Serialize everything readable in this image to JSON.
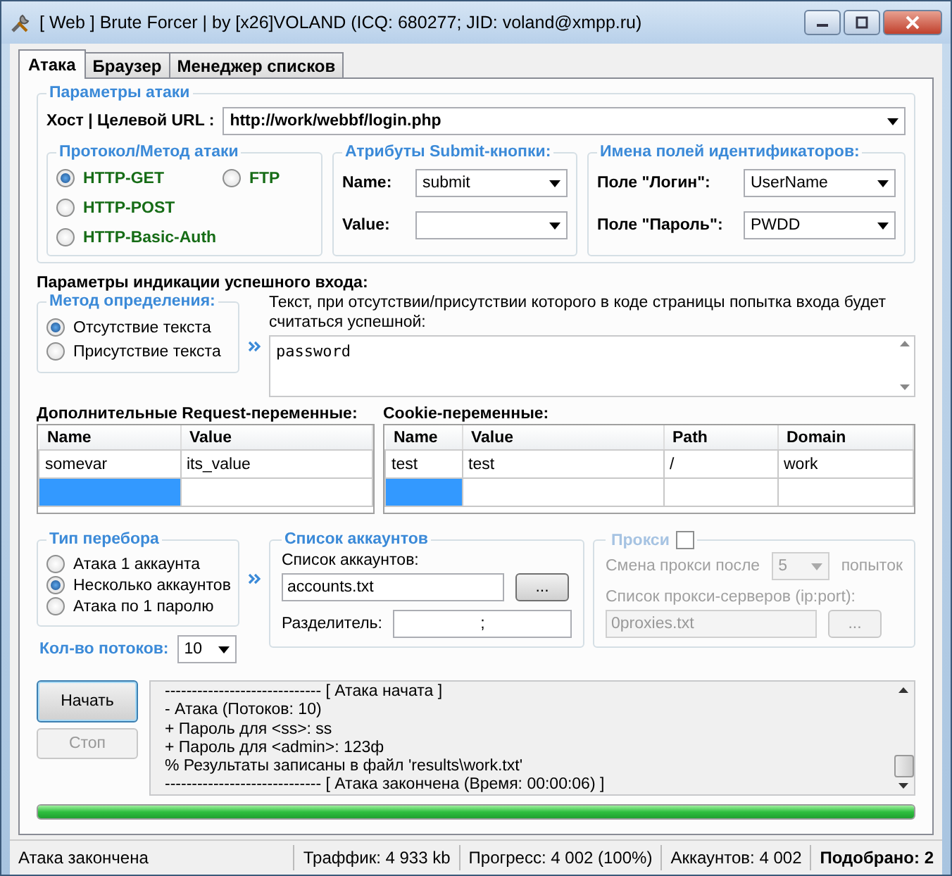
{
  "window": {
    "title": "[ Web ] Brute Forcer | by [x26]VOLAND (ICQ: 680277; JID: voland@xmpp.ru)"
  },
  "tabs": [
    {
      "label": "Атака",
      "selected": true
    },
    {
      "label": "Браузер",
      "selected": false
    },
    {
      "label": "Менеджер списков",
      "selected": false
    }
  ],
  "attack_params": {
    "title": "Параметры атаки",
    "host_label": "Хост | Целевой URL :",
    "host_value": "http://work/webbf/login.php"
  },
  "protocol": {
    "title": "Протокол/Метод атаки",
    "options": [
      {
        "label": "HTTP-GET",
        "selected": true
      },
      {
        "label": "FTP",
        "selected": false
      },
      {
        "label": "HTTP-POST",
        "selected": false
      },
      {
        "label": "HTTP-Basic-Auth",
        "selected": false
      }
    ]
  },
  "submit_attrs": {
    "title": "Атрибуты Submit-кнопки:",
    "fields": [
      {
        "label": "Name:",
        "value": "submit"
      },
      {
        "label": "Value:"
      }
    ]
  },
  "id_fields": {
    "title": "Имена полей идентификаторов:",
    "fields": [
      {
        "label": "Поле \"Логин\":",
        "value": "UserName"
      },
      {
        "label": "Поле \"Пароль\":",
        "value": "PWDD"
      }
    ]
  },
  "success": {
    "heading": "Параметры индикации успешного входа:",
    "method_title": "Метод определения:",
    "options": [
      {
        "label": "Отсутствие текста",
        "selected": true
      },
      {
        "label": "Присутствие текста",
        "selected": false
      }
    ],
    "description": "Текст, при отсутствии/присутствии которого в коде страницы попытка входа будет считаться успешной:",
    "text_value": "password"
  },
  "request_vars": {
    "title": "Дополнительные Request-переменные:",
    "columns": [
      "Name",
      "Value"
    ],
    "rows": [
      [
        "somevar",
        "its_value"
      ]
    ]
  },
  "cookie_vars": {
    "title": "Cookie-переменные:",
    "columns": [
      "Name",
      "Value",
      "Path",
      "Domain"
    ],
    "rows": [
      [
        "test",
        "test",
        "/",
        "work"
      ]
    ]
  },
  "brute_type": {
    "title": "Тип перебора",
    "options": [
      {
        "label": "Атака 1 аккаунта",
        "selected": false
      },
      {
        "label": "Несколько аккаунтов",
        "selected": true
      },
      {
        "label": "Атака по 1 паролю",
        "selected": false
      }
    ]
  },
  "threads": {
    "label": "Кол-во потоков:",
    "value": "10"
  },
  "accounts": {
    "title": "Список аккаунтов",
    "list_label": "Список аккаунтов:",
    "list_value": "accounts.txt",
    "browse": "...",
    "separator_label": "Разделитель:",
    "separator_value": ";"
  },
  "proxy": {
    "title": "Прокси",
    "enabled": false,
    "change_label": "Смена прокси после",
    "change_value": "5",
    "change_unit": "попыток",
    "list_label": "Список прокси-серверов (ip:port):",
    "list_value": "0proxies.txt",
    "browse": "..."
  },
  "buttons": [
    {
      "label": "Начать",
      "disabled": false
    },
    {
      "label": "Стоп",
      "disabled": true
    }
  ],
  "log": [
    "----------------------------- [ Атака начата ]",
    "- Атака (Потоков: 10)",
    "+ Пароль для <ss>: ss",
    "+ Пароль для <admin>: 123ф",
    "% Результаты записаны в файл 'results\\work.txt'",
    "----------------------------- [ Атака закончена (Время: 00:00:06) ]"
  ],
  "progress": {
    "level": 1.0
  },
  "status_bar": [
    "Атака закончена",
    "Траффик: 4 933 kb",
    "Прогресс: 4 002 (100%)",
    "Аккаунтов: 4 002",
    "Подобрано: 2"
  ]
}
